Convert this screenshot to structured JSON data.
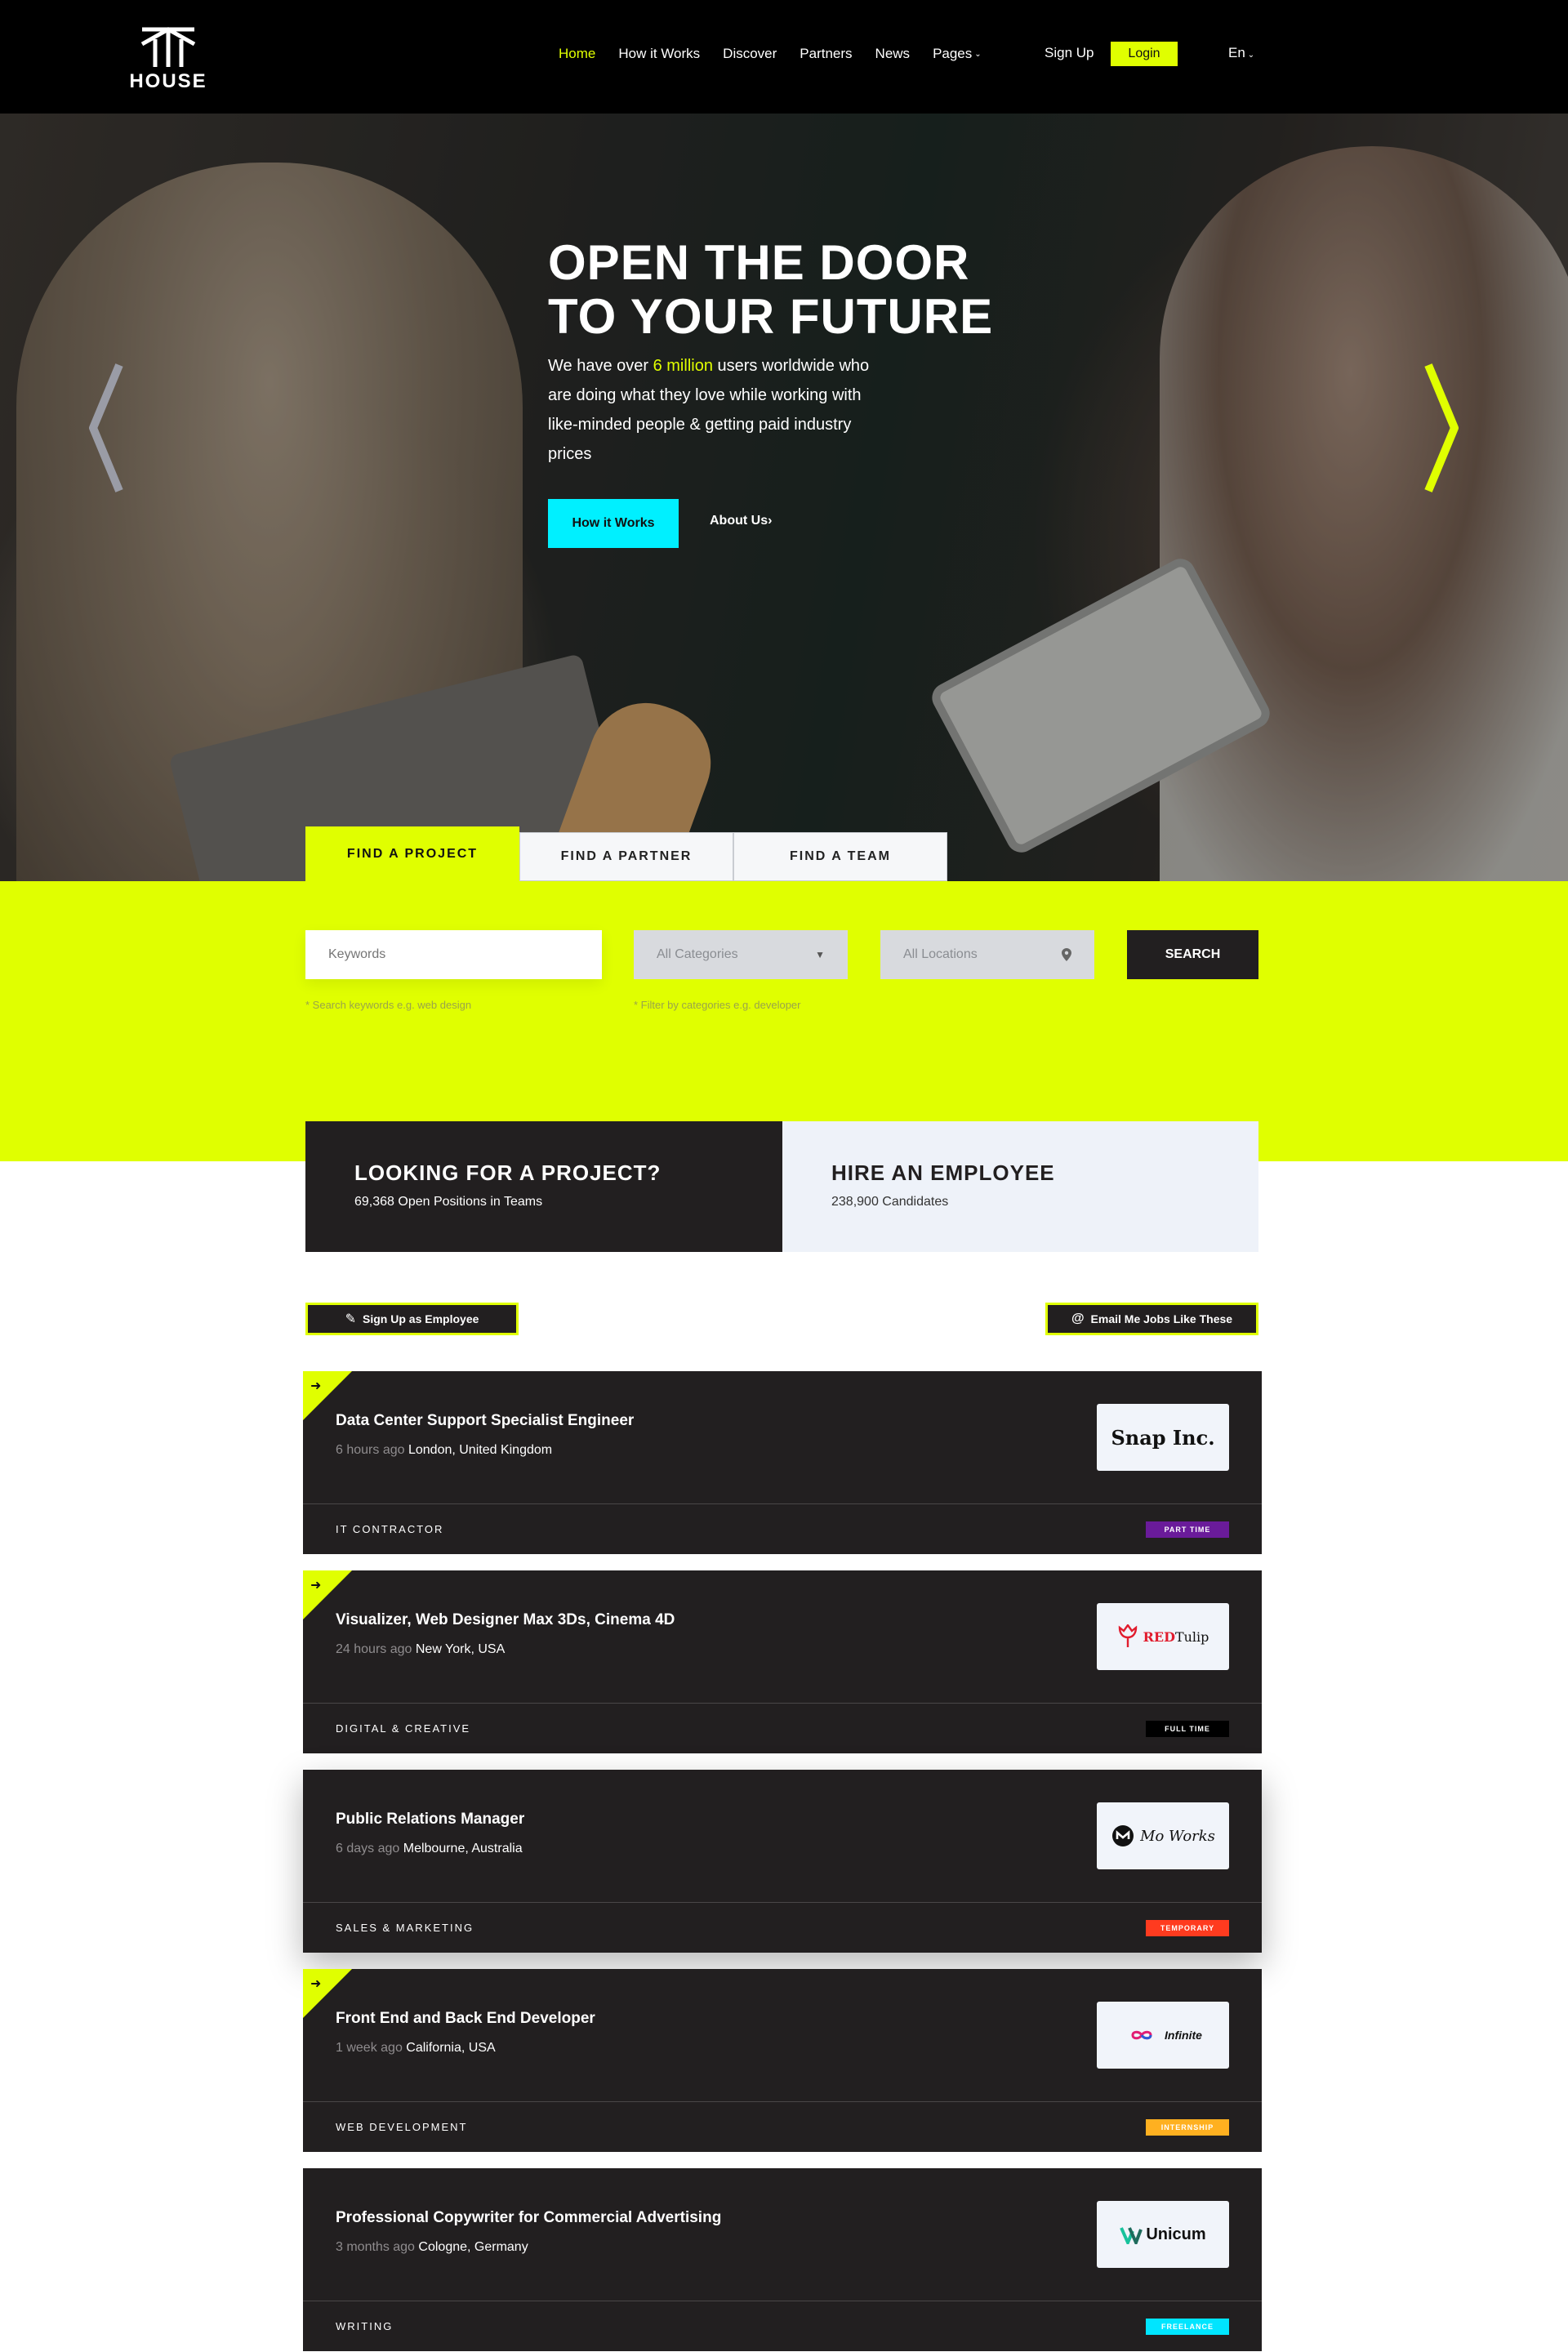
{
  "brand": {
    "name": "HOUSE"
  },
  "nav": {
    "items": [
      {
        "label": "Home",
        "active": true
      },
      {
        "label": "How it Works"
      },
      {
        "label": "Discover"
      },
      {
        "label": "Partners"
      },
      {
        "label": "News"
      },
      {
        "label": "Pages",
        "caret": true
      }
    ],
    "signup_label": "Sign Up",
    "login_label": "Login",
    "language": "En"
  },
  "hero": {
    "title_line1": "OPEN THE DOOR",
    "title_line2": "TO YOUR FUTURE",
    "desc_before": "We have over ",
    "desc_highlight": "6 million",
    "desc_after": " users worldwide who are doing what they love while working with like-minded people & getting paid industry prices",
    "primary_button": "How it Works",
    "secondary_link": "About Us"
  },
  "tabs": [
    {
      "label": "FIND A PROJECT",
      "active": true
    },
    {
      "label": "FIND A PARTNER"
    },
    {
      "label": "FIND A TEAM"
    }
  ],
  "search": {
    "keywords_placeholder": "Keywords",
    "categories_value": "All Categories",
    "locations_value": "All Locations",
    "button": "SEARCH",
    "hint_keywords": "* Search keywords e.g. web design",
    "hint_categories": "* Filter by categories e.g. developer"
  },
  "stats": {
    "project_title": "LOOKING FOR A PROJECT?",
    "project_sub": "69,368 Open Positions in Teams",
    "employee_title": "HIRE AN EMPLOYEE",
    "employee_sub": "238,900 Candidates"
  },
  "actions": {
    "signup_employee": "Sign Up as Employee",
    "email_jobs": "Email Me Jobs Like These"
  },
  "jobs": [
    {
      "title": "Data Center Support Specialist Engineer",
      "ago": "6 hours ago",
      "location": "London, United Kingdom",
      "category": "IT CONTRACTOR",
      "type": "PART TIME",
      "type_color": "#6a1b9a",
      "type_text_color": "#ffffff",
      "featured": true,
      "company": "Snap Inc."
    },
    {
      "title": "Visualizer, Web Designer Max 3Ds, Cinema 4D",
      "ago": "24 hours ago",
      "location": "New York, USA",
      "category": "DIGITAL & CREATIVE",
      "type": "FULL TIME",
      "type_color": "#000000",
      "type_text_color": "#ffffff",
      "featured": true,
      "company_prefix": "RED",
      "company_suffix": "Tulip"
    },
    {
      "title": "Public Relations Manager",
      "ago": "6 days ago",
      "location": "Melbourne, Australia",
      "category": "SALES & MARKETING",
      "type": "TEMPORARY",
      "type_color": "#ff3b1f",
      "type_text_color": "#ffffff",
      "featured": false,
      "company": "Mo Works"
    },
    {
      "title": "Front End and Back End Developer",
      "ago": "1 week ago",
      "location": "California, USA",
      "category": "WEB DEVELOPMENT",
      "type": "INTERNSHIP",
      "type_color": "#ffb020",
      "type_text_color": "#ffffff",
      "featured": true,
      "company": "Infinite"
    },
    {
      "title": "Professional Copywriter for Commercial Advertising",
      "ago": "3 months ago",
      "location": "Cologne, Germany",
      "category": "WRITING",
      "type": "FREELANCE",
      "type_color": "#00e5ff",
      "type_text_color": "#ffffff",
      "featured": false,
      "company": "Unicum"
    }
  ],
  "colors": {
    "accent": "#e0ff00",
    "cyan": "#00f0ff",
    "dark": "#221f20"
  }
}
